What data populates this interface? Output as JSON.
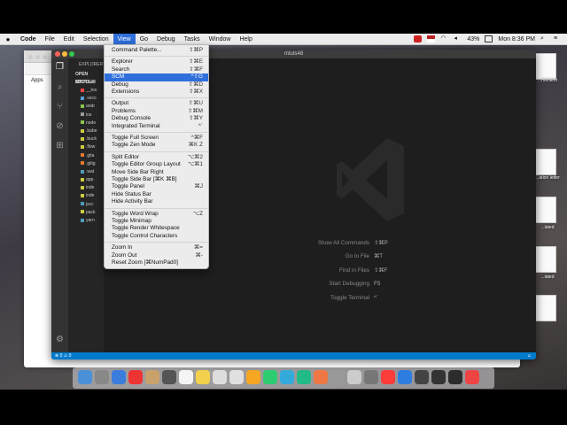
{
  "menubar": {
    "app": "Code",
    "items": [
      "File",
      "Edit",
      "Selection",
      "View",
      "Go",
      "Debug",
      "Tasks",
      "Window",
      "Help"
    ],
    "battery": "43%",
    "clock": "Mon 8:36 PM"
  },
  "chrome": {
    "apps": "Apps"
  },
  "desktop_files": [
    "...menient",
    "...ation letter",
    "...lated",
    "...lated",
    "..."
  ],
  "vscode": {
    "title": "mtuts48",
    "sidebar": {
      "header": "EXPLORER",
      "open_editors": "OPEN EDITO...",
      "project": "MTUTS48",
      "rows": [
        "__tes",
        ".vsco",
        "andr",
        "ios",
        "node",
        ".babe",
        ".buck",
        ".flow",
        ".gita",
        ".gitig",
        ".wat",
        "app.",
        "inde",
        "inde",
        "jscc",
        "pack",
        "yarn"
      ]
    },
    "shortcuts": [
      {
        "label": "Show All Commands",
        "key": "⇧⌘P"
      },
      {
        "label": "Go to File",
        "key": "⌘T"
      },
      {
        "label": "Find in Files",
        "key": "⇧⌘F"
      },
      {
        "label": "Start Debugging",
        "key": "F5"
      },
      {
        "label": "Toggle Terminal",
        "key": "^`"
      }
    ],
    "status": "⊗ 0 ⚠ 0"
  },
  "view_menu": [
    {
      "label": "Command Palette...",
      "key": "⇧⌘P"
    },
    {
      "sep": true
    },
    {
      "label": "Explorer",
      "key": "⇧⌘E"
    },
    {
      "label": "Search",
      "key": "⇧⌘F"
    },
    {
      "label": "SCM",
      "key": "^⇧G",
      "highlight": true
    },
    {
      "label": "Debug",
      "key": "⇧⌘D"
    },
    {
      "label": "Extensions",
      "key": "⇧⌘X"
    },
    {
      "sep": true
    },
    {
      "label": "Output",
      "key": "⇧⌘U"
    },
    {
      "label": "Problems",
      "key": "⇧⌘M"
    },
    {
      "label": "Debug Console",
      "key": "⇧⌘Y"
    },
    {
      "label": "Integrated Terminal",
      "key": "^`"
    },
    {
      "sep": true
    },
    {
      "label": "Toggle Full Screen",
      "key": "^⌘F"
    },
    {
      "label": "Toggle Zen Mode",
      "key": "⌘K Z"
    },
    {
      "sep": true
    },
    {
      "label": "Split Editor",
      "key": "⌥⌘2"
    },
    {
      "label": "Toggle Editor Group Layout",
      "key": "⌥⌘1"
    },
    {
      "label": "Move Side Bar Right",
      "key": ""
    },
    {
      "label": "Toggle Side Bar [⌘K ⌘B]",
      "key": ""
    },
    {
      "label": "Toggle Panel",
      "key": "⌘J"
    },
    {
      "label": "Hide Status Bar",
      "key": ""
    },
    {
      "label": "Hide Activity Bar",
      "key": ""
    },
    {
      "sep": true
    },
    {
      "label": "Toggle Word Wrap",
      "key": "⌥Z"
    },
    {
      "label": "Toggle Minimap",
      "key": ""
    },
    {
      "label": "Toggle Render Whitespace",
      "key": ""
    },
    {
      "label": "Toggle Control Characters",
      "key": ""
    },
    {
      "sep": true
    },
    {
      "label": "Zoom In",
      "key": "⌘="
    },
    {
      "label": "Zoom Out",
      "key": "⌘-"
    },
    {
      "label": "Reset Zoom [⌘NumPad0]",
      "key": ""
    }
  ],
  "colors": {
    "accent": "#2f6fdb",
    "vscode_status": "#007acc"
  }
}
